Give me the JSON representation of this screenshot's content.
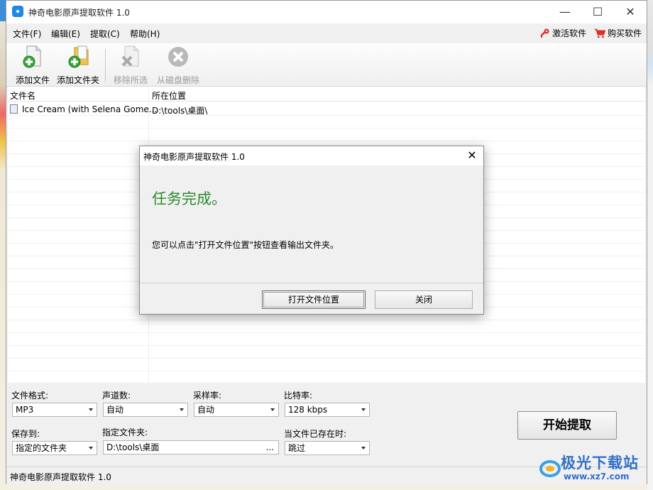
{
  "window": {
    "title": "神奇电影原声提取软件 1.0",
    "controls": {
      "minimize": "—",
      "maximize": "☐",
      "close": "✕"
    }
  },
  "menu": {
    "items": [
      "文件(F)",
      "编辑(E)",
      "提取(C)",
      "帮助(H)"
    ],
    "activate": "激活软件",
    "buy": "购买软件"
  },
  "toolbar": {
    "add_file": "添加文件",
    "add_folder": "添加文件夹",
    "remove_selected": "移除所选",
    "delete_from_disk": "从磁盘删除"
  },
  "list": {
    "columns": [
      "文件名",
      "所在位置"
    ],
    "rows": [
      {
        "name": "Ice Cream (with Selena Gome...",
        "location": "D:\\tools\\桌面\\"
      }
    ]
  },
  "options": {
    "format_label": "文件格式:",
    "format_value": "MP3",
    "channels_label": "声道数:",
    "channels_value": "自动",
    "sample_rate_label": "采样率:",
    "sample_rate_value": "自动",
    "bitrate_label": "比特率:",
    "bitrate_value": "128 kbps",
    "save_to_label": "保存到:",
    "save_to_value": "指定的文件夹",
    "folder_label": "指定文件夹:",
    "folder_value": "D:\\tools\\桌面",
    "folder_browse": "...",
    "exists_label": "当文件已存在时:",
    "exists_value": "跳过",
    "start_button": "开始提取"
  },
  "status": {
    "text": "神奇电影原声提取软件 1.0"
  },
  "dialog": {
    "title": "神奇电影原声提取软件 1.0",
    "close": "✕",
    "heading": "任务完成。",
    "message": "您可以点击\"打开文件位置\"按钮查看输出文件夹。",
    "open_location_button": "打开文件位置",
    "close_button": "关闭"
  },
  "watermark": {
    "text": "极光下载站",
    "url": "www.xz7.com"
  },
  "colors": {
    "success_green": "#2e8b2e",
    "accent_red": "#d9302b",
    "app_blue": "#1f86e6"
  }
}
